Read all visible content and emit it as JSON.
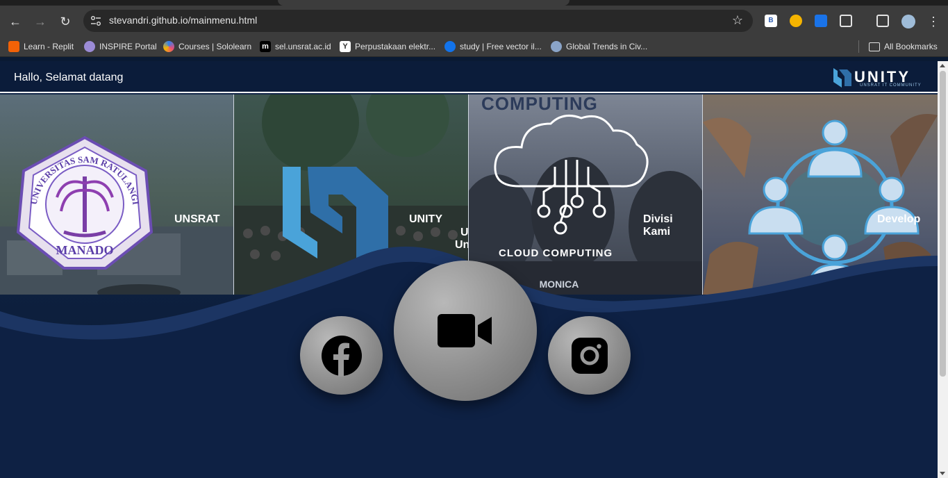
{
  "browser": {
    "url": "stevandri.github.io/mainmenu.html",
    "bookmarks": [
      {
        "label": "Learn - Replit",
        "icon": "replit-icon",
        "color": "#f26207"
      },
      {
        "label": "INSPIRE Portal",
        "icon": "inspire-icon",
        "color": "#9b8bd6"
      },
      {
        "label": "Courses | Sololearn",
        "icon": "sololearn-icon",
        "color": "#2f80ed"
      },
      {
        "label": "sel.unsrat.ac.id",
        "icon": "moodle-icon",
        "color": "#000000"
      },
      {
        "label": "Perpustakaan elektr...",
        "icon": "library-icon",
        "color": "#ffffff"
      },
      {
        "label": "study | Free vector il...",
        "icon": "freepik-icon",
        "color": "#1273eb"
      },
      {
        "label": "Global Trends in Civ...",
        "icon": "globe-icon",
        "color": "#8aa4c8"
      }
    ],
    "all_bookmarks": "All Bookmarks"
  },
  "header": {
    "greeting": "Hallo, Selamat datang",
    "logo_word": "UNITY",
    "logo_sub": "UNSRAT IT COMMUNITY"
  },
  "panels": [
    {
      "title": "UNSRAT",
      "seal_top": "UNIVERSITAS SAM RATULANGI",
      "seal_bottom": "MANADO"
    },
    {
      "title": "UNITY",
      "overflow_line1": "U",
      "overflow_line2": "Un"
    },
    {
      "title": "Divisi Kami",
      "banner": "COMPUTING",
      "caption": "CLOUD COMPUTING",
      "shirt": "MONICA"
    },
    {
      "title": "Develop"
    }
  ],
  "social": {
    "left": "facebook-icon",
    "center": "video-camera-icon",
    "right": "instagram-icon"
  },
  "colors": {
    "header_bg": "#0b1c3a",
    "wave_dark": "#0d1f3d",
    "accent_blue": "#4aa3d9"
  }
}
